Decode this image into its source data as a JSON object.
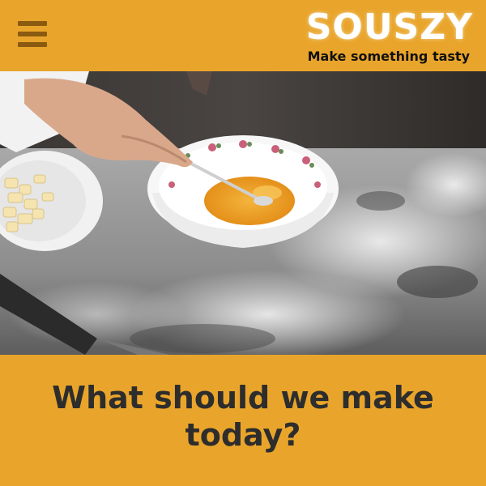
{
  "header": {
    "menu_icon": "hamburger-menu-icon",
    "brand": "SOUSZY",
    "tagline": "Make something tasty",
    "background_color": "#e9a52b"
  },
  "hero": {
    "image_description_icon": "egg-whisking-photo"
  },
  "prompt": {
    "heading": "What should we make today?"
  },
  "colors": {
    "accent": "#e9a52b",
    "heading_text": "#2d2d2d",
    "logo_text": "#ffffff"
  }
}
